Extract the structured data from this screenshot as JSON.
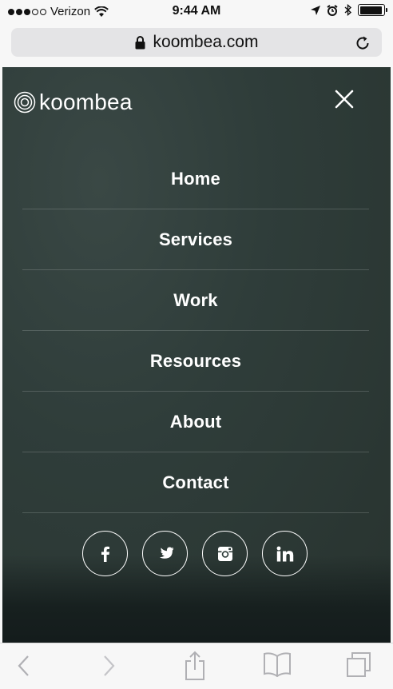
{
  "status_bar": {
    "carrier": "Verizon",
    "time": "9:44 AM",
    "signal_bars": 3,
    "battery_level": 0.95
  },
  "browser": {
    "url": "koombea.com"
  },
  "site": {
    "logo_text": "koombea",
    "menu": [
      {
        "label": "Home"
      },
      {
        "label": "Services"
      },
      {
        "label": "Work"
      },
      {
        "label": "Resources"
      },
      {
        "label": "About"
      },
      {
        "label": "Contact"
      }
    ],
    "socials": [
      "facebook-icon",
      "twitter-icon",
      "instagram-icon",
      "linkedin-icon"
    ]
  },
  "toolbar": {
    "icons": [
      "back-icon",
      "forward-icon",
      "share-icon",
      "bookmarks-icon",
      "tabs-icon"
    ]
  }
}
